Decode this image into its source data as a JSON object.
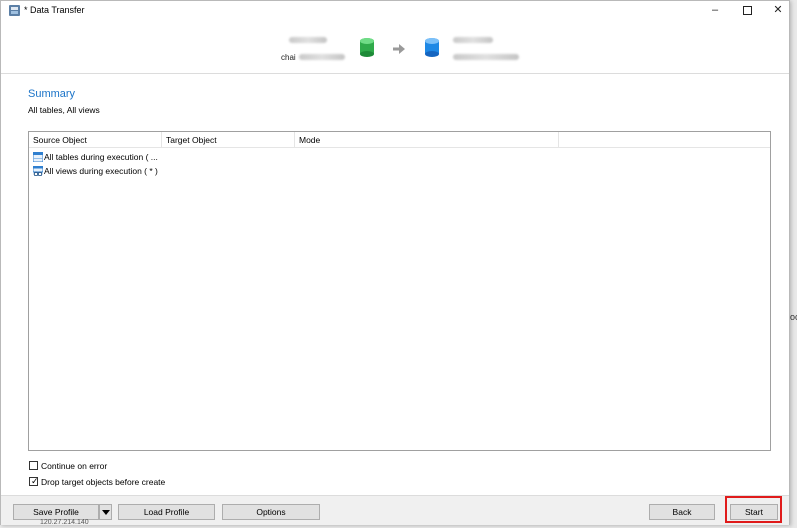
{
  "window": {
    "title": "* Data Transfer",
    "controls": {
      "minimize": "–",
      "close": "✕"
    }
  },
  "header": {
    "source": {
      "host": "",
      "name": "chai"
    },
    "target": {
      "host": "",
      "name": ""
    }
  },
  "summary": {
    "title": "Summary",
    "subtitle": "All tables, All views"
  },
  "table": {
    "columns": [
      "Source Object",
      "Target Object",
      "Mode"
    ],
    "rows": [
      {
        "source": "All tables during execution ( ...",
        "icon": "table-icon"
      },
      {
        "source": "All views during execution ( * )",
        "icon": "view-icon"
      }
    ]
  },
  "options": {
    "continue_on_error": {
      "label": "Continue on error",
      "checked": false
    },
    "drop_target": {
      "label": "Drop target objects before create",
      "checked": true,
      "tick": "✓"
    }
  },
  "footer": {
    "save_profile": "Save Profile",
    "load_profile": "Load Profile",
    "options": "Options",
    "back": "Back",
    "start": "Start"
  },
  "background": {
    "right_fragment": "oc",
    "bottom_fragment": "120.27.214.140"
  },
  "colors": {
    "accent": "#1a73c8",
    "highlight": "#e01b1b",
    "source_db": "#2faa4a",
    "target_db": "#1e88e5"
  }
}
